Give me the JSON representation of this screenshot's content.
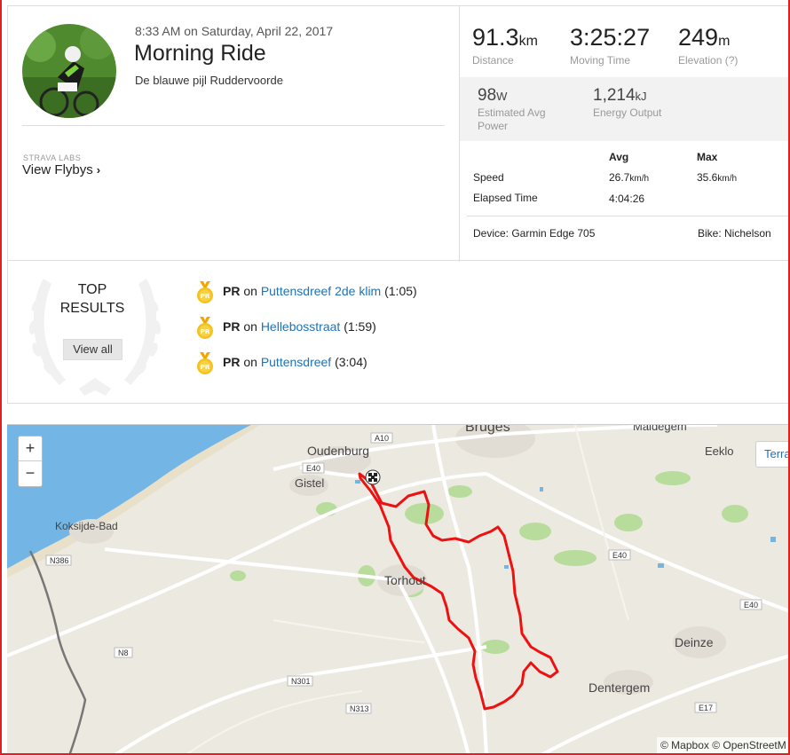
{
  "activity": {
    "datetime": "8:33 AM on Saturday, April 22, 2017",
    "title": "Morning Ride",
    "location": "De blauwe pijl Ruddervoorde"
  },
  "labs": {
    "tag": "STRAVA LABS",
    "flybys_label": "View Flybys",
    "chevron": "›"
  },
  "stats": {
    "distance": {
      "value": "91.3",
      "unit": "km",
      "label": "Distance"
    },
    "moving_time": {
      "value": "3:25:27",
      "label": "Moving Time"
    },
    "elevation": {
      "value": "249",
      "unit": "m",
      "label": "Elevation (?)"
    }
  },
  "extra_stats": {
    "power": {
      "value": "98",
      "unit": "W",
      "label_line1": "Estimated Avg",
      "label_line2": "Power"
    },
    "energy": {
      "value": "1,214",
      "unit": "kJ",
      "label": "Energy Output"
    }
  },
  "details": {
    "avg_header": "Avg",
    "max_header": "Max",
    "speed": {
      "label": "Speed",
      "avg": "26.7",
      "avg_unit": "km/h",
      "max": "35.6",
      "max_unit": "km/h"
    },
    "elapsed": {
      "label": "Elapsed Time",
      "avg": "4:04:26"
    },
    "device": "Device: Garmin Edge 705",
    "bike": "Bike: Nichelson"
  },
  "top_results": {
    "title_line1": "TOP",
    "title_line2": "RESULTS",
    "view_all": "View all",
    "items": [
      {
        "badge": "PR",
        "on": "on",
        "segment": "Puttensdreef 2de klim",
        "time": "(1:05)"
      },
      {
        "badge": "PR",
        "on": "on",
        "segment": "Hellebosstraat",
        "time": "(1:59)"
      },
      {
        "badge": "PR",
        "on": "on",
        "segment": "Puttensdreef",
        "time": "(3:04)"
      }
    ]
  },
  "map": {
    "zoom_in": "+",
    "zoom_out": "−",
    "terrain_label": "Terra",
    "attribution": "© Mapbox © OpenStreetM",
    "places": {
      "bruges": "Bruges",
      "maldegem": "Maldegem",
      "oudenburg": "Oudenburg",
      "gistel": "Gistel",
      "eeklo": "Eeklo",
      "koksijde": "Koksijde-Bad",
      "torhout": "Torhout",
      "deinze": "Deinze",
      "dentergem": "Dentergem"
    },
    "roads": {
      "a10": "A10",
      "e40_w": "E40",
      "e40_e": "E40",
      "e40_e2": "E40",
      "n386": "N386",
      "n8": "N8",
      "n301": "N301",
      "n313": "N313",
      "e17": "E17"
    },
    "colors": {
      "route": "#ee1111",
      "water": "#73b6e6",
      "land": "#ece9e1",
      "green": "#a8d88d"
    }
  }
}
